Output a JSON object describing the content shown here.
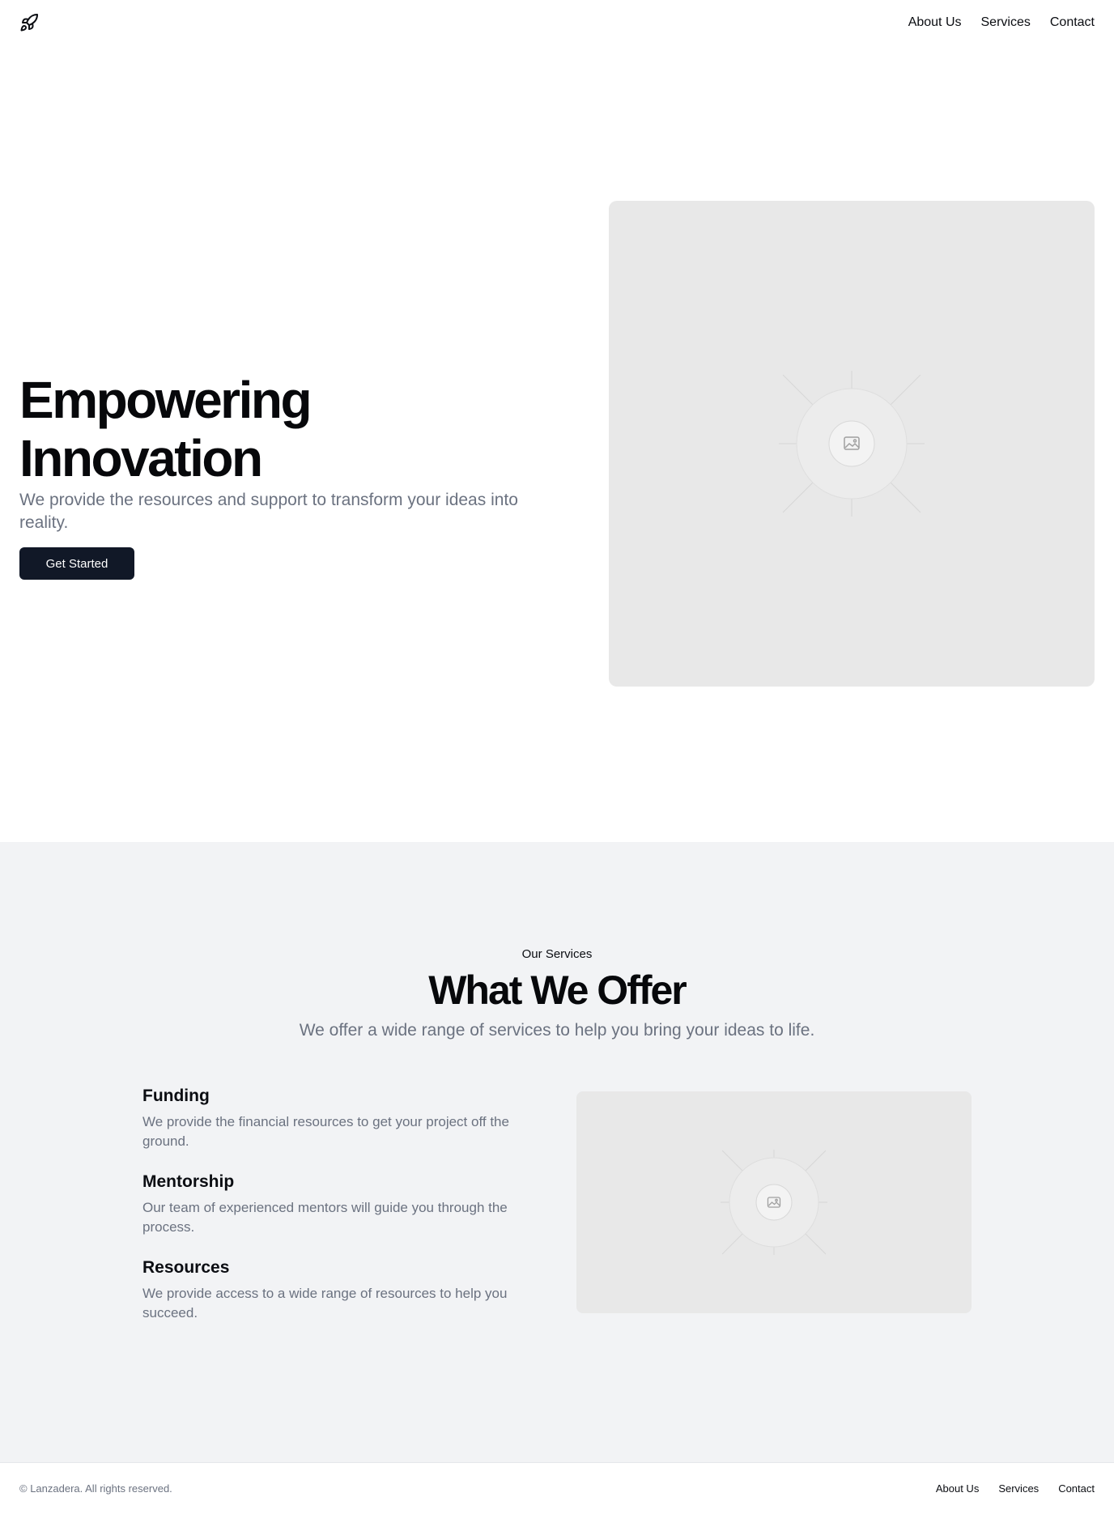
{
  "header": {
    "logo_icon": "rocket-icon",
    "nav": [
      "About Us",
      "Services",
      "Contact"
    ]
  },
  "hero": {
    "title": "Empowering Innovation",
    "subtitle": "We provide the resources and support to transform your ideas into reality.",
    "cta_label": "Get Started",
    "image_icon": "image-placeholder-icon"
  },
  "services": {
    "eyebrow": "Our Services",
    "title": "What We Offer",
    "subtitle": "We offer a wide range of services to help you bring your ideas to life.",
    "items": [
      {
        "title": "Funding",
        "description": "We provide the financial resources to get your project off the ground."
      },
      {
        "title": "Mentorship",
        "description": "Our team of experienced mentors will guide you through the process."
      },
      {
        "title": "Resources",
        "description": "We provide access to a wide range of resources to help you succeed."
      }
    ],
    "image_icon": "image-placeholder-icon"
  },
  "footer": {
    "copyright": "© Lanzadera. All rights reserved.",
    "nav": [
      "About Us",
      "Services",
      "Contact"
    ]
  },
  "colors": {
    "primary_button": "#111827",
    "muted_text": "#6b7280",
    "section_bg": "#f2f3f5",
    "placeholder_bg": "#e8e8e8"
  }
}
